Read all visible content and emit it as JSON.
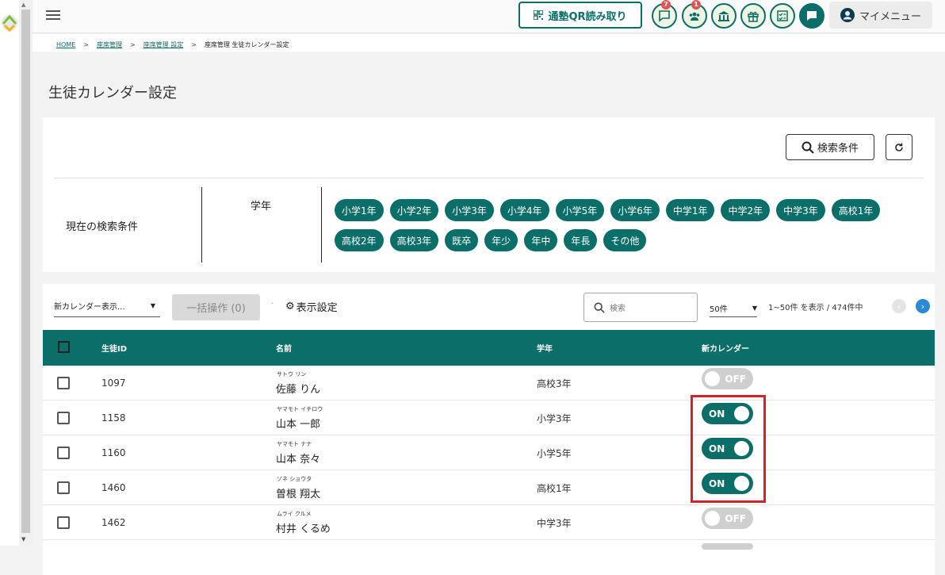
{
  "topbar": {
    "qr_label": "通塾QR読み取り",
    "badges": {
      "messages": "7",
      "students": "1"
    },
    "mymenu_label": "マイメニュー"
  },
  "breadcrumb": [
    "HOME",
    "座席管理",
    "座席管理 設定",
    "座席管理 生徒カレンダー設定"
  ],
  "page_title": "生徒カレンダー設定",
  "search": {
    "button_label": "検索条件",
    "current_label": "現在の検索条件",
    "grade_label": "学年",
    "chips": [
      "小学1年",
      "小学2年",
      "小学3年",
      "小学4年",
      "小学5年",
      "小学6年",
      "中学1年",
      "中学2年",
      "中学3年",
      "高校1年",
      "高校2年",
      "高校3年",
      "既卒",
      "年少",
      "年中",
      "年長",
      "その他"
    ]
  },
  "list": {
    "calendar_select": "新カレンダー表示...",
    "bulk_label": "一括操作 (0)",
    "display_settings": "表示設定",
    "search_placeholder": "検索",
    "per_page": "50件",
    "range": "1~50件 を表示 / 474件中",
    "headers": {
      "id": "生徒ID",
      "name": "名前",
      "grade": "学年",
      "calendar": "新カレンダー"
    },
    "rows": [
      {
        "id": "1097",
        "kana": "サトウ リン",
        "name": "佐藤 りん",
        "grade": "高校3年",
        "toggle": "OFF",
        "on": false
      },
      {
        "id": "1158",
        "kana": "ヤマモト イチロウ",
        "name": "山本 一郎",
        "grade": "小学3年",
        "toggle": "ON",
        "on": true
      },
      {
        "id": "1160",
        "kana": "ヤマモト ナナ",
        "name": "山本 奈々",
        "grade": "小学5年",
        "toggle": "ON",
        "on": true
      },
      {
        "id": "1460",
        "kana": "ソネ ショウタ",
        "name": "曽根 翔太",
        "grade": "高校1年",
        "toggle": "ON",
        "on": true
      },
      {
        "id": "1462",
        "kana": "ムライ クルメ",
        "name": "村井 くるめ",
        "grade": "中学3年",
        "toggle": "OFF",
        "on": false
      }
    ]
  },
  "colors": {
    "brand": "#0b6e69",
    "highlight": "#d9202a",
    "badge": "#e05454",
    "next": "#2a8ad8"
  }
}
